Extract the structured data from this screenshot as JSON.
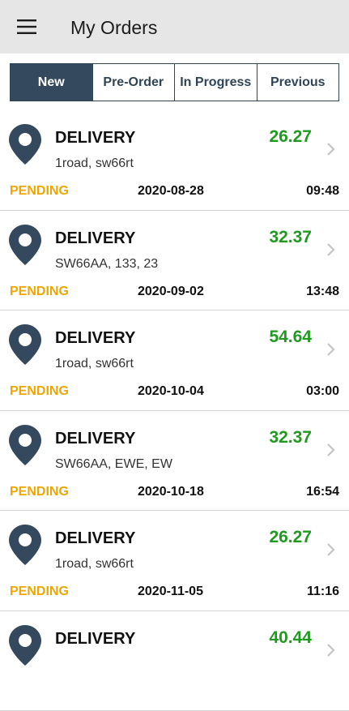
{
  "header": {
    "title": "My Orders",
    "menu_icon": "hamburger-menu-icon"
  },
  "tabs": [
    {
      "label": "New",
      "active": true
    },
    {
      "label": "Pre-Order",
      "active": false
    },
    {
      "label": "In Progress",
      "active": false
    },
    {
      "label": "Previous",
      "active": false
    }
  ],
  "orders": [
    {
      "type": "DELIVERY",
      "price": "26.27",
      "address": "1road, sw66rt",
      "status": "PENDING",
      "date": "2020-08-28",
      "time": "09:48"
    },
    {
      "type": "DELIVERY",
      "price": "32.37",
      "address": "SW66AA, 133, 23",
      "status": "PENDING",
      "date": "2020-09-02",
      "time": "13:48"
    },
    {
      "type": "DELIVERY",
      "price": "54.64",
      "address": "1road, sw66rt",
      "status": "PENDING",
      "date": "2020-10-04",
      "time": "03:00"
    },
    {
      "type": "DELIVERY",
      "price": "32.37",
      "address": "SW66AA, EWE, EW",
      "status": "PENDING",
      "date": "2020-10-18",
      "time": "16:54"
    },
    {
      "type": "DELIVERY",
      "price": "26.27",
      "address": "1road, sw66rt",
      "status": "PENDING",
      "date": "2020-11-05",
      "time": "11:16"
    },
    {
      "type": "DELIVERY",
      "price": "40.44",
      "address": "",
      "status": "",
      "date": "",
      "time": ""
    }
  ],
  "colors": {
    "header_bg": "#e6e6e6",
    "tab_active_bg": "#34495e",
    "pin": "#34495e",
    "price": "#1f9a1f",
    "status_pending": "#f0a500"
  },
  "icons": {
    "location": "location-pin-icon",
    "chevron": "chevron-right-icon"
  }
}
